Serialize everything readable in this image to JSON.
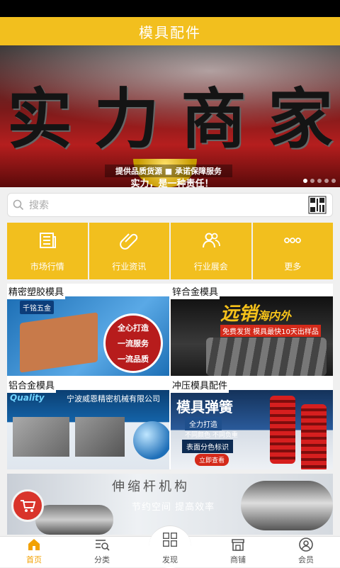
{
  "header": {
    "title": "模具配件"
  },
  "banner": {
    "headline_chars": [
      "实",
      "力",
      "商",
      "家"
    ],
    "line1": "提供品质货源 ■ 承诺保障服务",
    "line2": "实力，是一种责任！",
    "slide_count": 5,
    "active_slide": 1
  },
  "search": {
    "placeholder": "搜索",
    "icon": "search-icon",
    "scan_icon": "qr-scan-icon"
  },
  "quick_links": [
    {
      "label": "市场行情",
      "icon": "newspaper-icon"
    },
    {
      "label": "行业资讯",
      "icon": "paperclip-icon"
    },
    {
      "label": "行业展会",
      "icon": "people-icon"
    },
    {
      "label": "更多",
      "icon": "more-dots-icon"
    }
  ],
  "categories": [
    {
      "label": "精密塑胶模具",
      "art": {
        "brand": "千铭五金",
        "badge_top": "全心打造",
        "badge_mid": "一流服务",
        "badge_bot": "一流品质"
      }
    },
    {
      "label": "锌合金模具",
      "art": {
        "promo": "远销",
        "promo_small": "海内外",
        "note": "免费发货 模具最快10天出样品"
      }
    },
    {
      "label": "铝合金模具",
      "art": {
        "logo": "Quality",
        "company": "宁波威恩精密机械有限公司"
      }
    },
    {
      "label": "冲压模具配件",
      "art": {
        "title": "模具弹簧",
        "sub": "全力打造",
        "sub2": "不同颜色 不同负重",
        "sub3": "表面分色标识",
        "button": "立即查看"
      }
    }
  ],
  "promo_banner": {
    "title": "伸缩杆机构",
    "subtitle": "节约空间 提高效率"
  },
  "cart_button": {
    "icon": "cart-icon"
  },
  "tabbar": {
    "tabs": [
      {
        "label": "首页",
        "icon": "home-icon",
        "active": true
      },
      {
        "label": "分类",
        "icon": "category-search-icon",
        "active": false
      },
      {
        "label": "发现",
        "icon": "grid-icon",
        "active": false
      },
      {
        "label": "商铺",
        "icon": "shop-icon",
        "active": false
      },
      {
        "label": "会员",
        "icon": "user-icon",
        "active": false
      }
    ]
  },
  "colors": {
    "accent": "#f2bf1e",
    "active_tab": "#f2a100",
    "cart": "#d9342b"
  }
}
